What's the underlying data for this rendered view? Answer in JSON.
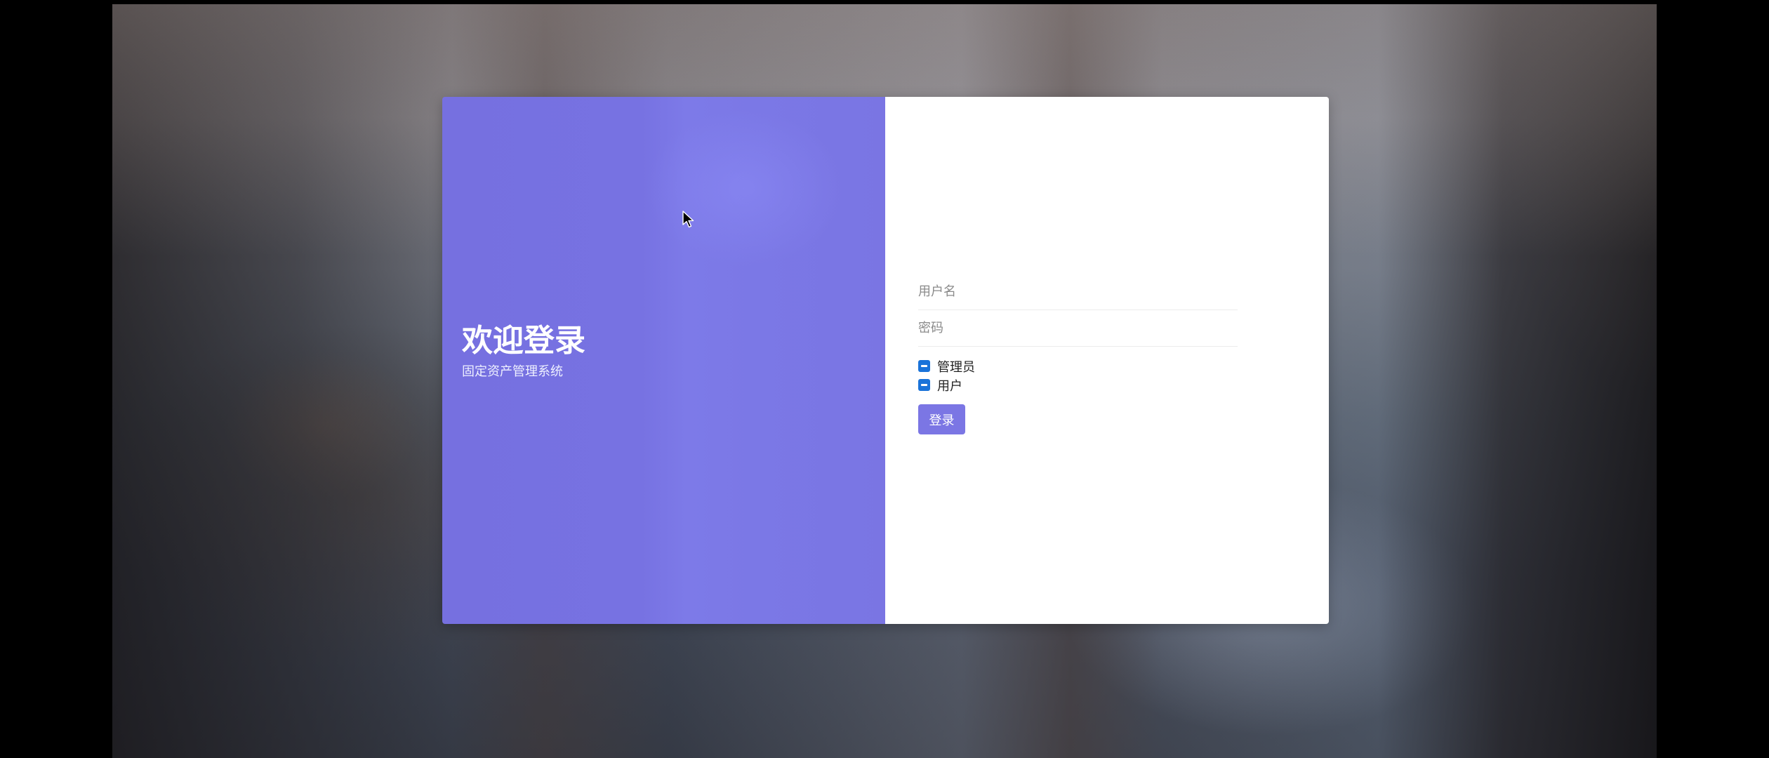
{
  "welcome": {
    "title": "欢迎登录",
    "subtitle": "固定资产管理系统"
  },
  "form": {
    "username_placeholder": "用户名",
    "password_placeholder": "密码",
    "roles": [
      {
        "label": "管理员",
        "state": "indeterminate"
      },
      {
        "label": "用户",
        "state": "indeterminate"
      }
    ],
    "login_label": "登录"
  },
  "colors": {
    "panel_accent": "#7772e2",
    "button": "#7b76e4",
    "checkbox": "#1a73d9"
  },
  "icons": {
    "cursor": "mouse-pointer-icon",
    "checkbox": "checkbox-indeterminate-icon"
  }
}
